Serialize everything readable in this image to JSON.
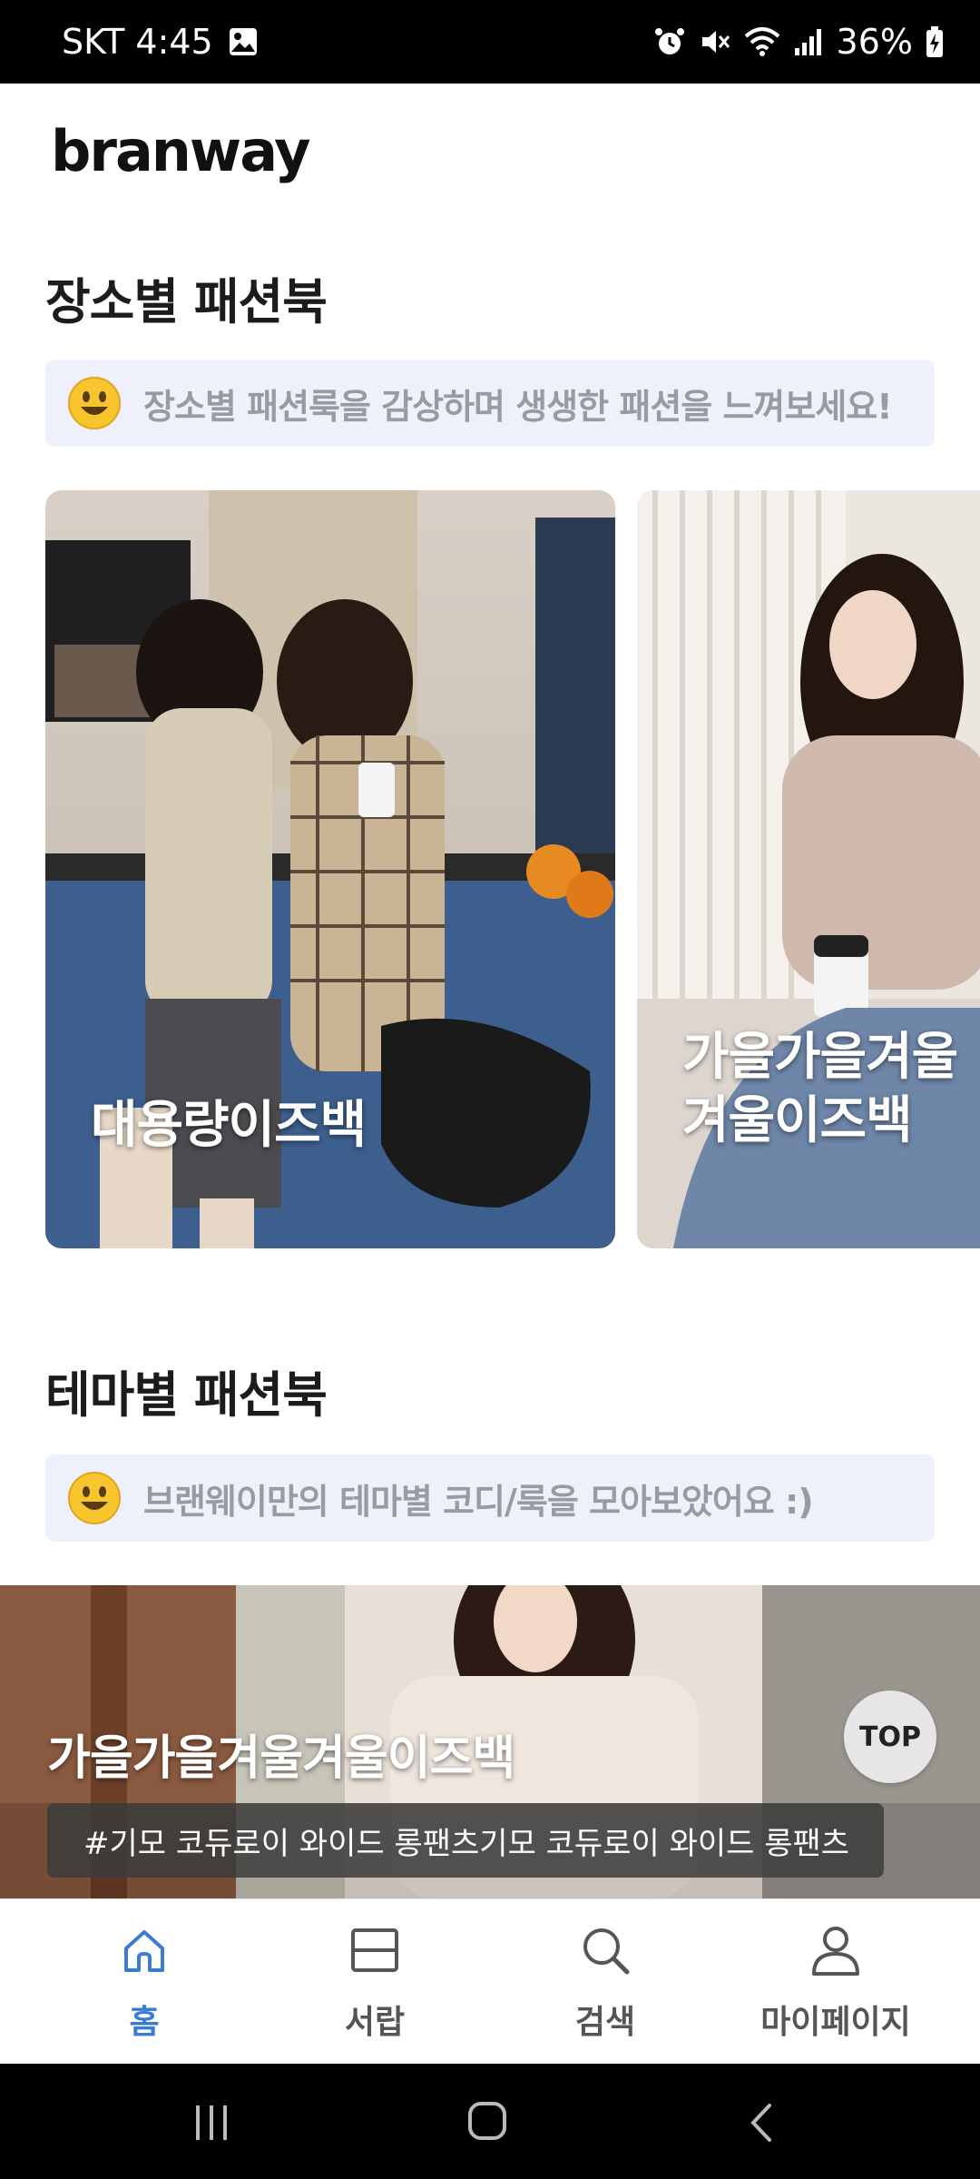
{
  "status_bar": {
    "carrier_time": "SKT 4:45",
    "battery": "36%"
  },
  "app": {
    "logo": "branway"
  },
  "section_place": {
    "title": "장소별 패션북",
    "notice": "장소별 패션룩을 감상하며 생생한 패션을 느껴보세요!",
    "cards": [
      {
        "label": "대용량이즈백"
      },
      {
        "label": "가을가을겨울겨울이즈백"
      }
    ]
  },
  "section_theme": {
    "title": "테마별 패션북",
    "notice": "브랜웨이만의 테마별 코디/룩을 모아보았어요 :)",
    "banner": {
      "title": "가을가을겨울겨울이즈백",
      "tag": "#기모 코듀로이 와이드 롱팬츠기모 코듀로이 와이드 롱팬츠"
    }
  },
  "top_button": "TOP",
  "tabs": [
    {
      "label": "홈",
      "icon": "home-icon",
      "active": true
    },
    {
      "label": "서랍",
      "icon": "drawer-icon",
      "active": false
    },
    {
      "label": "검색",
      "icon": "search-icon",
      "active": false
    },
    {
      "label": "마이페이지",
      "icon": "person-icon",
      "active": false
    }
  ],
  "colors": {
    "accent": "#3a7bd5",
    "notice_bg": "#eef0fb"
  }
}
